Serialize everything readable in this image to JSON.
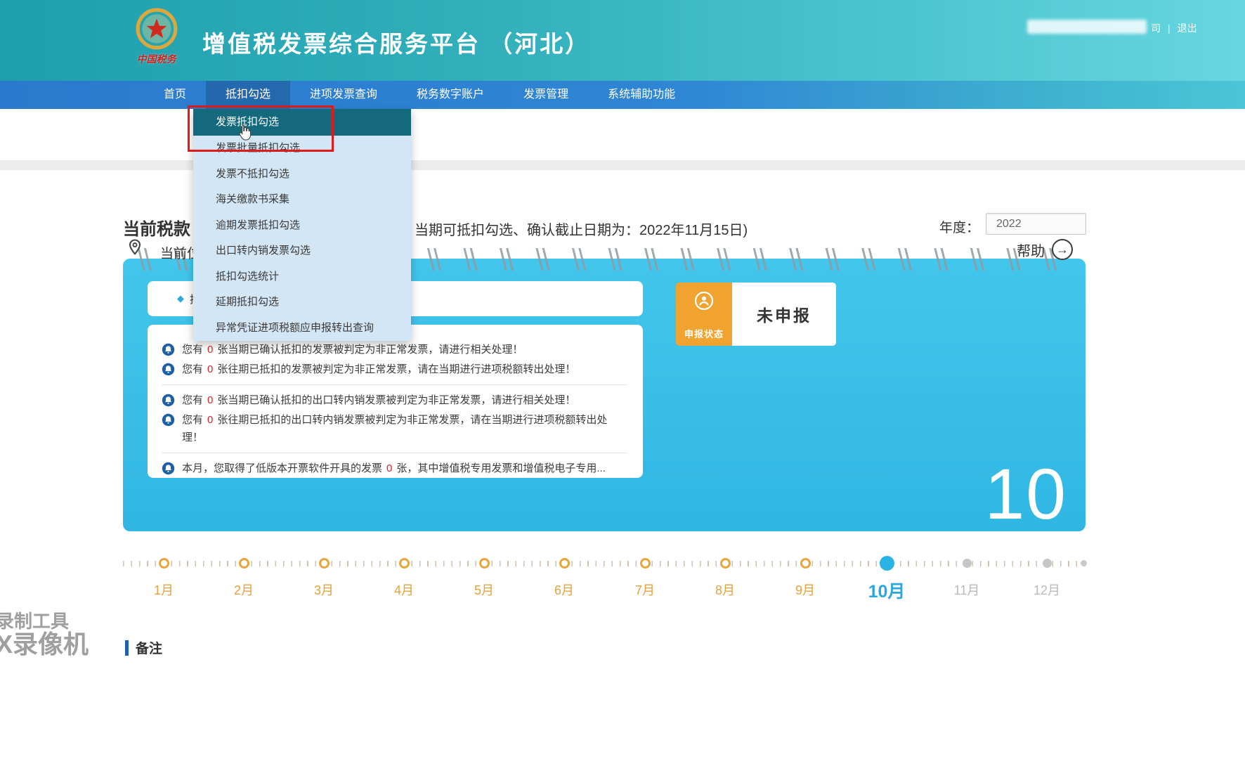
{
  "header": {
    "logo_caption": "中国税务",
    "title": "增值税发票综合服务平台 （河北）",
    "account_suffix": "司",
    "separator": "|",
    "logout": "退出"
  },
  "nav": {
    "items": [
      {
        "label": "首页"
      },
      {
        "label": "抵扣勾选"
      },
      {
        "label": "进项发票查询"
      },
      {
        "label": "税务数字账户"
      },
      {
        "label": "发票管理"
      },
      {
        "label": "系统辅助功能"
      }
    ]
  },
  "dropdown": {
    "items": [
      {
        "label": "发票抵扣勾选"
      },
      {
        "label": "发票批量抵扣勾选"
      },
      {
        "label": "发票不抵扣勾选"
      },
      {
        "label": "海关缴款书采集"
      },
      {
        "label": "逾期发票抵扣勾选"
      },
      {
        "label": "出口转内销发票勾选"
      },
      {
        "label": "抵扣勾选统计"
      },
      {
        "label": "延期抵扣勾选"
      },
      {
        "label": "异常凭证进项税额应申报转出查询"
      }
    ]
  },
  "breadcrumb": {
    "label": "当前位",
    "help": "帮助",
    "help_arrow": "→"
  },
  "main": {
    "title_left": "当前税款",
    "title_right": "当期可抵扣勾选、确认截止日期为：2022年11月15日)",
    "year_label": "年度：",
    "year_value": "2022",
    "card_bullet": "◆",
    "card_bullet_label": "抵扣",
    "status_badge_label": "申报状态",
    "status_value": "未申报",
    "big_month": "10",
    "notices": [
      {
        "pre": "您有",
        "count": "0",
        "post": "张当期已确认抵扣的发票被判定为非正常发票，请进行相关处理！"
      },
      {
        "pre": "您有",
        "count": "0",
        "post": "张往期已抵扣的发票被判定为非正常发票，请在当期进行进项税额转出处理！"
      },
      {
        "pre": "您有",
        "count": "0",
        "post": "张当期已确认抵扣的出口转内销发票被判定为非正常发票，请进行相关处理！"
      },
      {
        "pre": "您有",
        "count": "0",
        "post": "张往期已抵扣的出口转内销发票被判定为非正常发票，请在当期进行进项税额转出处理！"
      },
      {
        "pre": "本月，您取得了低版本开票软件开具的发票",
        "count": "0",
        "post": "张，其中增值税专用发票和增值税电子专用..."
      }
    ]
  },
  "timeline": {
    "months": [
      {
        "label": "1月",
        "state": "past"
      },
      {
        "label": "2月",
        "state": "past"
      },
      {
        "label": "3月",
        "state": "past"
      },
      {
        "label": "4月",
        "state": "past"
      },
      {
        "label": "5月",
        "state": "past"
      },
      {
        "label": "6月",
        "state": "past"
      },
      {
        "label": "7月",
        "state": "past"
      },
      {
        "label": "8月",
        "state": "past"
      },
      {
        "label": "9月",
        "state": "past"
      },
      {
        "label": "10月",
        "state": "current"
      },
      {
        "label": "11月",
        "state": "future"
      },
      {
        "label": "12月",
        "state": "future"
      }
    ]
  },
  "footer": {
    "remarks": "备注"
  },
  "watermark": {
    "line1": "录制工具",
    "line2": "X录像机"
  },
  "colors": {
    "header_teal": "#1f9fae",
    "nav_blue": "#2b79ce",
    "card_cyan": "#38bde7",
    "accent_blue": "#2aa7de",
    "badge_orange": "#f0a32f",
    "alert_red": "#e02020",
    "annotation_red": "#e01919",
    "dropdown_bg": "#d3e6f5",
    "dropdown_selected": "#15697d"
  }
}
